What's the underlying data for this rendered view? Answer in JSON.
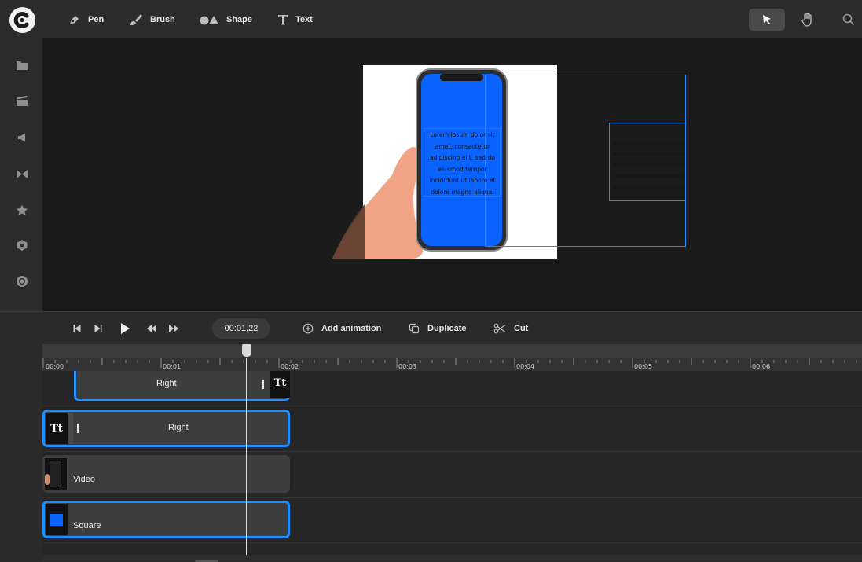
{
  "toolbar": {
    "tools": [
      {
        "id": "pen",
        "label": "Pen",
        "icon": "pen-icon"
      },
      {
        "id": "brush",
        "label": "Brush",
        "icon": "brush-icon"
      },
      {
        "id": "shape",
        "label": "Shape",
        "icon": "shape-icon"
      },
      {
        "id": "text",
        "label": "Text",
        "icon": "text-icon"
      }
    ],
    "right_icons": [
      "pointer-icon",
      "hand-icon",
      "search-icon"
    ]
  },
  "sidebar": {
    "icons": [
      "folder-icon",
      "clapperboard-icon",
      "speaker-icon",
      "transition-icon",
      "star-icon",
      "hexagon-icon",
      "record-icon"
    ]
  },
  "canvas": {
    "text_box": "Lorem ipsum dolor sit amet, consectetur adipiscing elit, sed do eiusmod tempor incididunt ut labore et dolore magna aliqua.",
    "colors": {
      "screen_blue": "#0a63ff",
      "selection": "#1f8fff",
      "background": "#1b1b1b"
    }
  },
  "player": {
    "timecode": "00:01,22",
    "add_animation": "Add animation",
    "duplicate": "Duplicate",
    "cut": "Cut"
  },
  "timeline": {
    "ticks": [
      "00:00",
      "00:01",
      "00:02",
      "00:03",
      "00:04",
      "00:05",
      "00:06"
    ],
    "tracks": [
      {
        "label": "Right",
        "type": "text",
        "selected": true,
        "thumb": "Tt"
      },
      {
        "label": "Right",
        "type": "text",
        "selected": true,
        "thumb": "Tt"
      },
      {
        "label": "Video",
        "type": "video",
        "selected": false
      },
      {
        "label": "Square",
        "type": "shape",
        "selected": true
      }
    ]
  }
}
